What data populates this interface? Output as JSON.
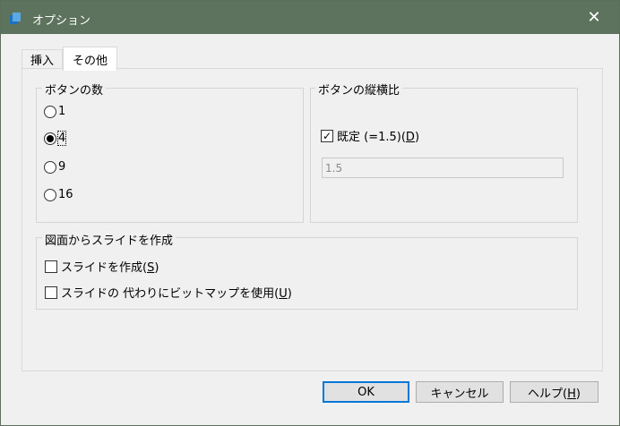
{
  "window": {
    "title": "オプション",
    "close_glyph": "✕"
  },
  "tabs": [
    {
      "label": "挿入"
    },
    {
      "label": "その他"
    }
  ],
  "button_count": {
    "legend": "ボタンの数",
    "options": [
      {
        "label": "1",
        "selected": false
      },
      {
        "label": "4",
        "selected": true
      },
      {
        "label": "9",
        "selected": false
      },
      {
        "label": "16",
        "selected": false
      }
    ]
  },
  "aspect_ratio": {
    "legend": "ボタンの縦横比",
    "default_label": "既定 (=1.5)(",
    "default_accel": "D",
    "default_checked": true,
    "ratio_value": "1.5"
  },
  "slides": {
    "legend": "図面からスライドを作成",
    "create_label": "スライドを作成(",
    "create_accel": "S",
    "create_checked": false,
    "bitmap_label": "スライドの 代わりにビットマップを使用(",
    "bitmap_accel": "U",
    "bitmap_checked": false
  },
  "buttons": {
    "ok": "OK",
    "cancel": "キャンセル",
    "help_label": "ヘルプ(",
    "help_accel": "H"
  },
  "colors": {
    "titlebar": "#5e735e",
    "app_icon": "#1e73be",
    "default_button_border": "#0078d7"
  }
}
